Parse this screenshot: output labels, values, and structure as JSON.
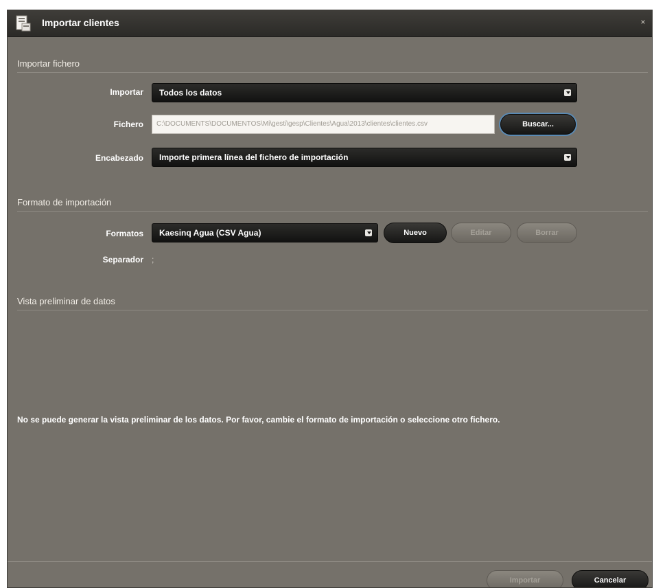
{
  "window": {
    "title": "Importar clientes",
    "close_glyph": "×"
  },
  "import_file": {
    "section_title": "Importar fichero",
    "import_label": "Importar",
    "import_value": "Todos los datos",
    "file_label": "Fichero",
    "file_value": "C:\\DOCUMENTS\\DOCUMENTOS\\Mi\\gesti\\gesp\\Clientes\\Agua\\2013\\clientes\\clientes.csv",
    "browse_label": "Buscar...",
    "header_label": "Encabezado",
    "header_value": "Importe primera línea del fichero de importación"
  },
  "import_format": {
    "section_title": "Formato de importación",
    "format_label": "Formatos",
    "format_value": "Kaesinq Agua (CSV Agua)",
    "new_label": "Nuevo",
    "edit_label": "Editar",
    "delete_label": "Borrar",
    "separator_label": "Separador",
    "separator_value": ";"
  },
  "preview": {
    "section_title": "Vista preliminar de datos",
    "message": "No se puede generar la vista preliminar de los datos. Por favor, cambie el formato de importación o seleccione otro fichero."
  },
  "footer": {
    "import_label": "Importar",
    "cancel_label": "Cancelar"
  },
  "icons": {
    "title_icon": "document-import-icon",
    "close_icon": "close-icon",
    "dropdown_icon": "chevron-down-icon"
  },
  "colors": {
    "window_bg": "#75716a",
    "titlebar_bg": "#2b2a27",
    "focus_ring": "#5a8ab4"
  }
}
